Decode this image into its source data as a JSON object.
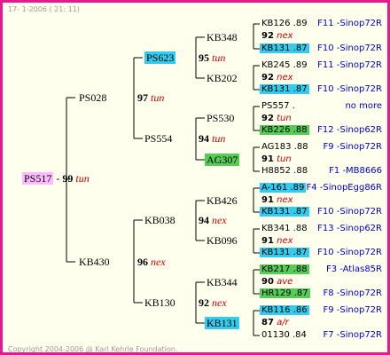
{
  "header": "17-  1-2006 ( 21: 11)",
  "footer": "Copyright 2004-2006 @ Karl Kehrle Foundation.",
  "colors": {
    "border": "#e8198c",
    "background": "#ffffee",
    "lines": "#000000",
    "highlight_root": "#ffbbff",
    "highlight_cyan": "#33ccee",
    "highlight_green": "#55cc55",
    "suffix": "#cc0000",
    "right_text": "#0000cc"
  },
  "root": {
    "name": "PS517",
    "year": "99",
    "suffix": "tun"
  },
  "gen1": [
    {
      "name": "PS028",
      "year": "97",
      "suffix": "tun"
    },
    {
      "name": "KB430",
      "year": "96",
      "suffix": "nex"
    }
  ],
  "gen2": [
    {
      "name": "PS623",
      "year": "95",
      "suffix": "tun"
    },
    {
      "name": "PS554",
      "year": "94",
      "suffix": "tun"
    },
    {
      "name": "KB038",
      "year": "94",
      "suffix": "nex"
    },
    {
      "name": "KB130",
      "year": "92",
      "suffix": "nex"
    }
  ],
  "gen3": [
    {
      "name": "KB348"
    },
    {
      "name": "KB202"
    },
    {
      "name": "PS530"
    },
    {
      "name": "AG307"
    },
    {
      "name": "KB426"
    },
    {
      "name": "KB096"
    },
    {
      "name": "KB344"
    },
    {
      "name": "KB131"
    }
  ],
  "gen4": [
    {
      "name": "KB126 .89",
      "right": "F11 -Sinop72R"
    },
    {
      "name": "92",
      "suffix": "nex",
      "right": ""
    },
    {
      "name": "KB131 .87",
      "right": "F10 -Sinop72R"
    },
    {
      "name": "KB245 .89",
      "right": "F11 -Sinop72R"
    },
    {
      "name": "92",
      "suffix": "nex",
      "right": ""
    },
    {
      "name": "KB131 .87",
      "right": "F10 -Sinop72R"
    },
    {
      "name": "PS557 .",
      "right": "no more"
    },
    {
      "name": "92",
      "suffix": "tun",
      "right": ""
    },
    {
      "name": "KB226 .88",
      "right": "F12 -Sinop62R"
    },
    {
      "name": "AG183 .88",
      "right": "F9 -Sinop72R"
    },
    {
      "name": "91",
      "suffix": "tun",
      "right": ""
    },
    {
      "name": "H8852 .88",
      "right": "F1 -MB8666"
    },
    {
      "name": "A-161 .89",
      "right": "F4 -SinopEgg86R"
    },
    {
      "name": "91",
      "suffix": "nex",
      "right": ""
    },
    {
      "name": "KB131 .87",
      "right": "F10 -Sinop72R"
    },
    {
      "name": "KB341 .88",
      "right": "F13 -Sinop62R"
    },
    {
      "name": "91",
      "suffix": "nex",
      "right": ""
    },
    {
      "name": "KB131 .87",
      "right": "F10 -Sinop72R"
    },
    {
      "name": "KB217 .88",
      "right": "F3 -Atlas85R"
    },
    {
      "name": "90",
      "suffix": "ave",
      "right": ""
    },
    {
      "name": "HR129 .87",
      "right": "F8 -Sinop72R"
    },
    {
      "name": "KB116 .86",
      "right": "F9 -Sinop72R"
    },
    {
      "name": "87",
      "suffix": "a/r",
      "right": ""
    },
    {
      "name": "01130 .84",
      "right": "F7 -Sinop72R"
    }
  ]
}
